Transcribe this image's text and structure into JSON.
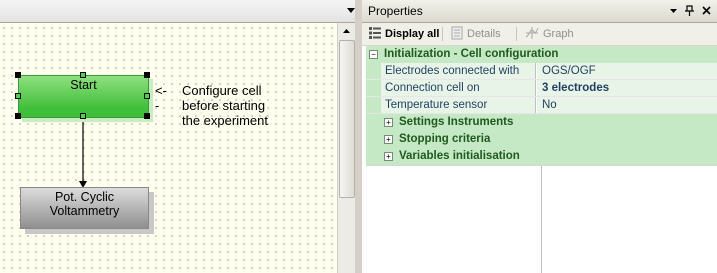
{
  "designer": {
    "menu_icon": "triangle-down-icon",
    "nodes": {
      "start": "Start",
      "cv_line1": "Pot. Cyclic",
      "cv_line2": "Voltammetry"
    },
    "annotation": {
      "arrow": "<--",
      "line1": "Configure cell",
      "line2": "before starting",
      "line3": "the experiment"
    }
  },
  "properties": {
    "title": "Properties",
    "title_buttons": [
      "dropdown-icon",
      "pin-icon",
      "close-icon"
    ],
    "toolbar": {
      "display_all": "Display all",
      "details": "Details",
      "graph": "Graph"
    },
    "groups": [
      {
        "label": "Initialization - Cell configuration",
        "expanded": true,
        "properties": [
          {
            "name": "Electrodes connected with",
            "value": "OGS/OGF",
            "bold": false
          },
          {
            "name": "Connection cell on",
            "value": "3 electrodes",
            "bold": true
          },
          {
            "name": "Temperature sensor",
            "value": "No",
            "bold": false
          }
        ]
      },
      {
        "label": "Settings Instruments",
        "expanded": false
      },
      {
        "label": "Stopping criteria",
        "expanded": false
      },
      {
        "label": "Variables initialisation",
        "expanded": false
      }
    ],
    "expander_collapsed": "+",
    "expander_expanded": "−"
  },
  "colors": {
    "start_node": "#3fbf39",
    "category_band": "#c5e8c5",
    "property_text": "#1f3f5f"
  }
}
